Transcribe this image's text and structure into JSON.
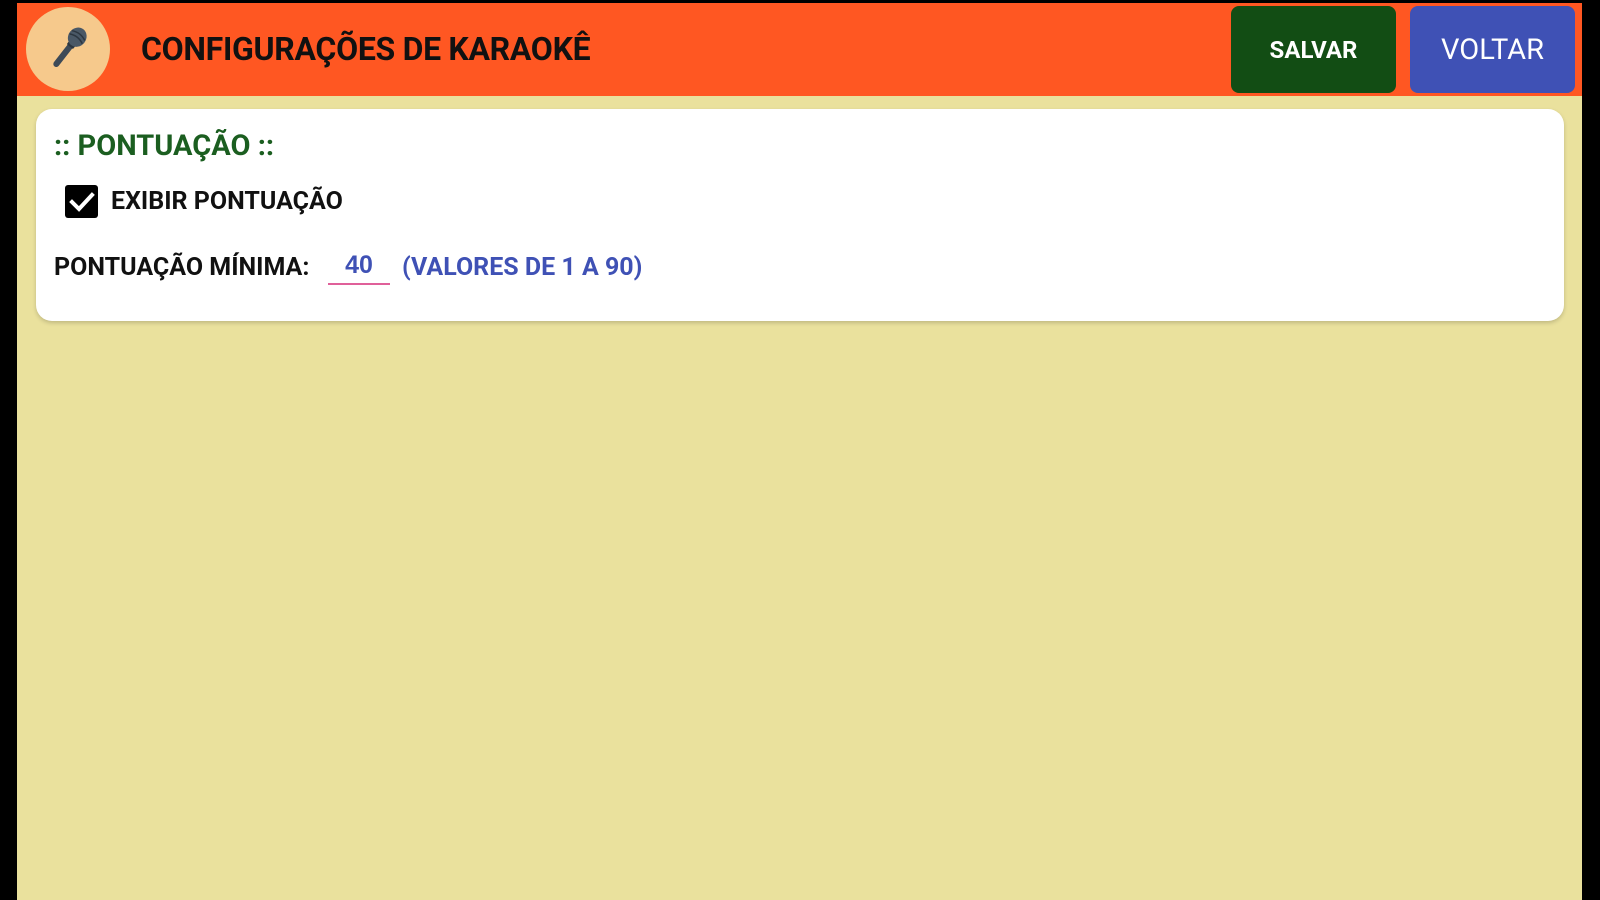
{
  "header": {
    "icon": "microphone-icon",
    "title": "CONFIGURAÇÕES DE KARAOKÊ",
    "save_label": "SALVAR",
    "back_label": "VOLTAR"
  },
  "scoring": {
    "section_title": ":: PONTUAÇÃO ::",
    "show_score_label": "EXIBIR PONTUAÇÃO",
    "show_score_checked": true,
    "min_score_label": "PONTUAÇÃO MÍNIMA:",
    "min_score_value": "40",
    "range_hint": "(VALORES DE 1 A 90)"
  },
  "colors": {
    "header_bg": "#FF5722",
    "save_button": "#124D14",
    "back_button": "#3F51B5",
    "page_bg": "#EAE19D",
    "section_title": "#1B5E20",
    "accent_text": "#3F51B5",
    "input_underline": "#E0609A",
    "icon_circle": "#F6C98C"
  }
}
